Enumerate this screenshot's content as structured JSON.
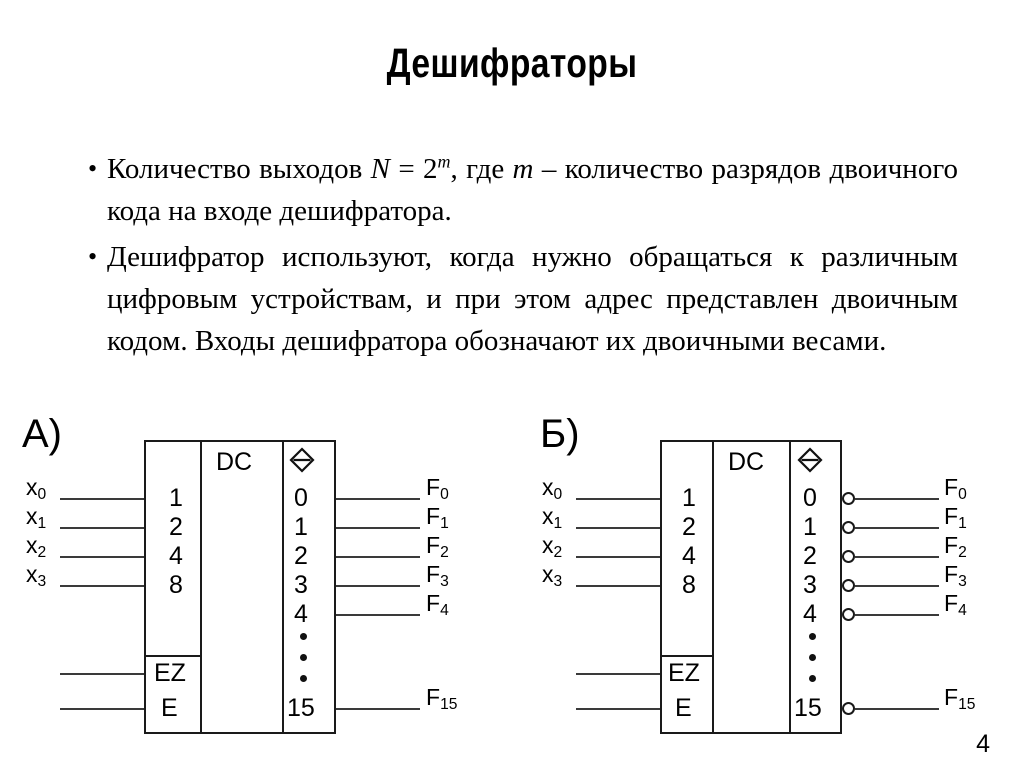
{
  "slide": {
    "title": "Дешифраторы",
    "page_number": "4"
  },
  "body": {
    "bullet_marker": "•",
    "bullets": [
      {
        "id": "bullet-outputs-count",
        "parts": [
          {
            "t": "Количество  выходов  "
          },
          {
            "t": "N",
            "style": "italic"
          },
          {
            "t": "  =  "
          },
          {
            "t": "2",
            "sup": "m"
          },
          {
            "t": ",  где  "
          },
          {
            "t": "m",
            "style": "italic"
          },
          {
            "t": "  –  количество разрядов двоичного кода на входе дешифратора."
          }
        ],
        "plain": "Количество выходов N = 2m, где m – количество разрядов двоичного кода на входе дешифратора."
      },
      {
        "id": "bullet-usage",
        "parts": [
          {
            "t": "Дешифратор используют, когда нужно обращаться к различным цифровым устройствам, и при этом адрес представлен двоичным кодом. Входы дешифратора обозначают их двоичными весами."
          }
        ],
        "plain": "Дешифратор используют, когда нужно обращаться к различным цифровым устройствам, и при этом адрес представлен двоичным кодом. Входы дешифратора обозначают их двоичными весами."
      }
    ]
  },
  "diagrams": [
    {
      "id": "diagram-a",
      "label": "А)",
      "chip_name": "DC",
      "output_symbol": "diamond-with-bar",
      "inverted_outputs": false,
      "input_labels": [
        "x0",
        "x1",
        "x2",
        "x3"
      ],
      "input_label_text": [
        "x",
        "x",
        "x",
        "x"
      ],
      "input_label_sub": [
        "0",
        "1",
        "2",
        "3"
      ],
      "input_weights": [
        "1",
        "2",
        "4",
        "8"
      ],
      "enable_pins": [
        "EZ",
        "E"
      ],
      "output_indices": [
        "0",
        "1",
        "2",
        "3",
        "4"
      ],
      "output_ellipsis": "•••",
      "output_last_index": "15",
      "output_label_text": [
        "F",
        "F",
        "F",
        "F",
        "F"
      ],
      "output_label_sub": [
        "0",
        "1",
        "2",
        "3",
        "4"
      ],
      "output_last_label_text": "F",
      "output_last_label_sub": "15"
    },
    {
      "id": "diagram-b",
      "label": "Б)",
      "chip_name": "DC",
      "output_symbol": "diamond-with-bar",
      "inverted_outputs": true,
      "input_labels": [
        "x0",
        "x1",
        "x2",
        "x3"
      ],
      "input_label_text": [
        "x",
        "x",
        "x",
        "x"
      ],
      "input_label_sub": [
        "0",
        "1",
        "2",
        "3"
      ],
      "input_weights": [
        "1",
        "2",
        "4",
        "8"
      ],
      "enable_pins": [
        "EZ",
        "E"
      ],
      "output_indices": [
        "0",
        "1",
        "2",
        "3",
        "4"
      ],
      "output_ellipsis": "•••",
      "output_last_index": "15",
      "output_label_text": [
        "F",
        "F",
        "F",
        "F",
        "F"
      ],
      "output_label_sub": [
        "0",
        "1",
        "2",
        "3",
        "4"
      ],
      "output_last_label_text": "F",
      "output_last_label_sub": "15"
    }
  ],
  "colors": {
    "ink": "#000000",
    "line": "#1a1a1a",
    "wire": "#3a3a3a",
    "background": "#ffffff"
  }
}
